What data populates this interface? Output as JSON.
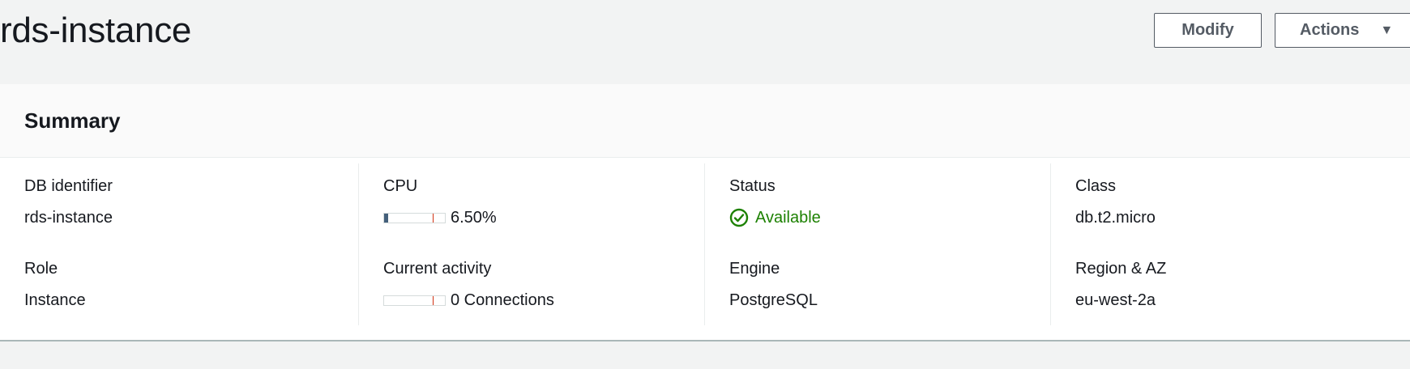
{
  "page": {
    "title": "rds-instance",
    "modify_label": "Modify",
    "actions_label": "Actions",
    "actions_icon": "caret-down-icon"
  },
  "summary": {
    "title": "Summary",
    "columns": [
      {
        "fields": [
          {
            "label": "DB identifier",
            "value": "rds-instance"
          },
          {
            "label": "Role",
            "value": "Instance"
          }
        ]
      },
      {
        "fields": [
          {
            "label": "CPU",
            "value": "6.50%",
            "meter_percent": 6.5
          },
          {
            "label": "Current activity",
            "value": "0 Connections",
            "meter_percent": 0
          }
        ]
      },
      {
        "fields": [
          {
            "label": "Status",
            "value": "Available",
            "icon": "check-circle-icon",
            "color": "#1d8102"
          },
          {
            "label": "Engine",
            "value": "PostgreSQL"
          }
        ]
      },
      {
        "fields": [
          {
            "label": "Class",
            "value": "db.t2.micro"
          },
          {
            "label": "Region & AZ",
            "value": "eu-west-2a"
          }
        ]
      }
    ]
  }
}
